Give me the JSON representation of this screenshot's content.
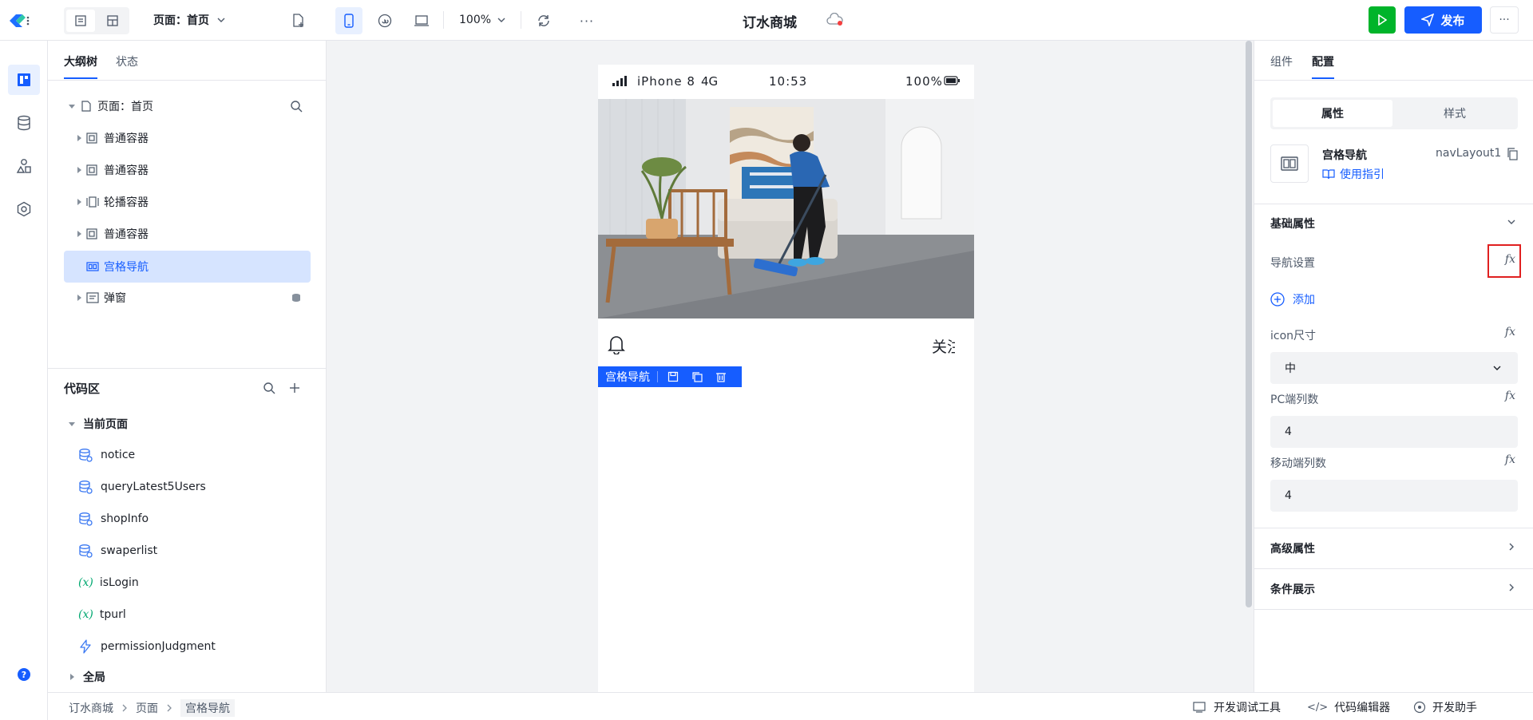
{
  "topbar": {
    "page_selector": "页面：首页",
    "zoom": "100%",
    "app_title": "订水商城",
    "more_label": "···",
    "publish_label": "发布"
  },
  "left_panel": {
    "tabs": [
      "大纲树",
      "状态"
    ],
    "tree": {
      "root": "页面：首页",
      "items": [
        {
          "label": "普通容器"
        },
        {
          "label": "普通容器"
        },
        {
          "label": "轮播容器"
        },
        {
          "label": "普通容器"
        },
        {
          "label": "宫格导航"
        },
        {
          "label": "弹窗"
        }
      ]
    },
    "code_title": "代码区",
    "current_page_label": "当前页面",
    "code_items": [
      {
        "label": "notice",
        "icon": "database-icon"
      },
      {
        "label": "queryLatest5Users",
        "icon": "database-icon"
      },
      {
        "label": "shopInfo",
        "icon": "database-icon"
      },
      {
        "label": "swaperlist",
        "icon": "database-icon"
      },
      {
        "label": "isLogin",
        "icon": "variable-icon",
        "prefix": "(x)"
      },
      {
        "label": "tpurl",
        "icon": "variable-icon",
        "prefix": "(x)"
      },
      {
        "label": "permissionJudgment",
        "icon": "lightning-icon"
      }
    ],
    "global_label": "全局"
  },
  "phone": {
    "status_device": "iPhone 8",
    "status_net": "4G",
    "status_time": "10:53",
    "status_battery": "100%",
    "nav_text": "关注",
    "selection_tag": "宫格导航"
  },
  "right_panel": {
    "tabs": [
      "组件",
      "配置"
    ],
    "segment": [
      "属性",
      "样式"
    ],
    "component_name": "宫格导航",
    "component_id": "navLayout1",
    "guide_link": "使用指引",
    "basic_section": "基础属性",
    "nav_settings_label": "导航设置",
    "add_label": "添加",
    "icon_size_label": "icon尺寸",
    "icon_size_value": "中",
    "pc_cols_label": "PC端列数",
    "pc_cols_value": "4",
    "mobile_cols_label": "移动端列数",
    "mobile_cols_value": "4",
    "advanced_section": "高级属性",
    "condition_section": "条件展示",
    "fx_label": "fx"
  },
  "bottombar": {
    "breadcrumb": [
      "订水商城",
      "页面",
      "宫格导航"
    ],
    "dev_tools": "开发调试工具",
    "code_editor": "代码编辑器",
    "dev_assistant": "开发助手"
  },
  "colors": {
    "accent": "#165dff",
    "run_button": "#00b42a",
    "highlight_box": "#e02020"
  }
}
